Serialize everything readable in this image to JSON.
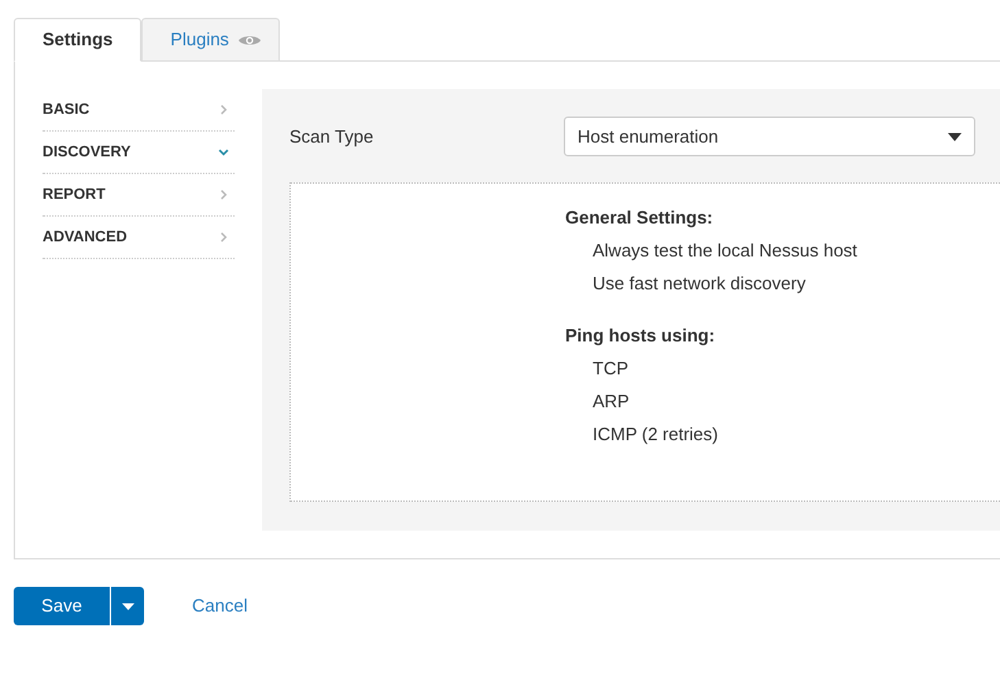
{
  "tabs": [
    {
      "label": "Settings",
      "selected": true,
      "icon": false
    },
    {
      "label": "Plugins",
      "selected": false,
      "icon": true
    }
  ],
  "sidebar": {
    "items": [
      {
        "label": "BASIC",
        "expanded": false
      },
      {
        "label": "DISCOVERY",
        "expanded": true
      },
      {
        "label": "REPORT",
        "expanded": false
      },
      {
        "label": "ADVANCED",
        "expanded": false
      }
    ]
  },
  "scan_type": {
    "label": "Scan Type",
    "value": "Host enumeration"
  },
  "summary": [
    {
      "heading": "General Settings:",
      "items": [
        "Always test the local Nessus host",
        "Use fast network discovery"
      ]
    },
    {
      "heading": "Ping hosts using:",
      "items": [
        "TCP",
        "ARP",
        "ICMP (2 retries)"
      ]
    }
  ],
  "footer": {
    "save": "Save",
    "cancel": "Cancel"
  }
}
